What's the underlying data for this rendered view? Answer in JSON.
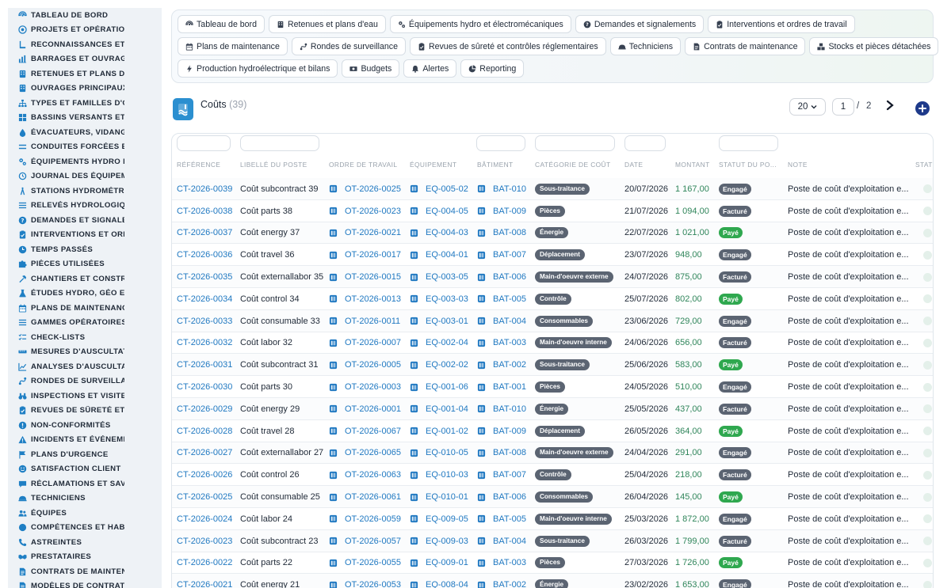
{
  "sidebar": {
    "items": [
      {
        "label": "TABLEAU DE BORD",
        "icon": "dashboard-icon"
      },
      {
        "label": "PROJETS ET OPÉRATIONS",
        "icon": "target-icon"
      },
      {
        "label": "RECONNAISSANCES ET VISITES",
        "icon": "map-pin-icon"
      },
      {
        "label": "BARRAGES ET OUVRAGES",
        "icon": "chart-icon"
      },
      {
        "label": "RETENUES ET PLANS D'EAU",
        "icon": "building-icon"
      },
      {
        "label": "OUVRAGES PRINCIPAUX",
        "icon": "building-icon"
      },
      {
        "label": "TYPES ET FAMILLES D'OUVRAGES",
        "icon": "sitemap-icon"
      },
      {
        "label": "BASSINS VERSANTS ET AFFLUENTS",
        "icon": "grid-icon"
      },
      {
        "label": "ÉVACUATEURS, VIDANGES",
        "icon": "drop-icon"
      },
      {
        "label": "CONDUITES FORCÉES ET GALERIES",
        "icon": "lines-icon"
      },
      {
        "label": "ÉQUIPEMENTS HYDRO ET ÉLECTROMÉCANIQUES",
        "icon": "gears-icon"
      },
      {
        "label": "JOURNAL DES ÉQUIPEMENTS",
        "icon": "history-icon"
      },
      {
        "label": "STATIONS HYDROMÉTRIQUES",
        "icon": "tower-icon"
      },
      {
        "label": "RELEVÉS HYDROLOGIQUES",
        "icon": "list-icon"
      },
      {
        "label": "DEMANDES ET SIGNALEMENTS",
        "icon": "question-icon"
      },
      {
        "label": "INTERVENTIONS ET ORDRES DE TRAVAIL",
        "icon": "clipboard-icon"
      },
      {
        "label": "TEMPS PASSÉS",
        "icon": "clock-icon"
      },
      {
        "label": "PIÈCES UTILISÉES",
        "icon": "puzzle-icon"
      },
      {
        "label": "CHANTIERS ET CONSTRUCTIONS",
        "icon": "hammer-icon"
      },
      {
        "label": "ÉTUDES HYDRO, GÉO ET STRUCTURE",
        "icon": "flask-icon"
      },
      {
        "label": "PLANS DE MAINTENANCE",
        "icon": "calendar-icon"
      },
      {
        "label": "GAMMES OPÉRATOIRES",
        "icon": "list-icon"
      },
      {
        "label": "CHECK-LISTS",
        "icon": "checklist-icon"
      },
      {
        "label": "MESURES D'AUSCULTATION",
        "icon": "ruler-icon"
      },
      {
        "label": "ANALYSES D'AUSCULTATION",
        "icon": "line-chart-icon"
      },
      {
        "label": "RONDES DE SURVEILLANCE",
        "icon": "route-icon"
      },
      {
        "label": "INSPECTIONS ET VISITES",
        "icon": "binoculars-icon"
      },
      {
        "label": "REVUES DE SÛRETÉ ET CONTRÔLES",
        "icon": "clipboard-icon"
      },
      {
        "label": "NON-CONFORMITÉS",
        "icon": "alert-circle-icon"
      },
      {
        "label": "INCIDENTS ET ÉVÉNEMENTS",
        "icon": "warning-icon"
      },
      {
        "label": "PLANS D'URGENCE",
        "icon": "flag-icon"
      },
      {
        "label": "SATISFACTION CLIENT",
        "icon": "smile-icon"
      },
      {
        "label": "RÉCLAMATIONS ET SAV",
        "icon": "chat-icon"
      },
      {
        "label": "TECHNICIENS",
        "icon": "helmet-icon"
      },
      {
        "label": "ÉQUIPES",
        "icon": "users-icon"
      },
      {
        "label": "COMPÉTENCES ET HABILITATIONS",
        "icon": "star-icon"
      },
      {
        "label": "ASTREINTES",
        "icon": "phone-icon"
      },
      {
        "label": "PRESTATAIRES",
        "icon": "handshake-icon"
      },
      {
        "label": "CONTRATS DE MAINTENANCE",
        "icon": "file-icon"
      },
      {
        "label": "MODÈLES DE CONTRATS",
        "icon": "file-icon"
      }
    ]
  },
  "toolbar": {
    "rows": [
      [
        {
          "label": "Tableau de bord",
          "icon": "dashboard-icon"
        },
        {
          "label": "Retenues et plans d'eau",
          "icon": "building-icon"
        },
        {
          "label": "Équipements hydro et électromécaniques",
          "icon": "gears-icon"
        },
        {
          "label": "Demandes et signalements",
          "icon": "question-icon"
        },
        {
          "label": "Interventions et ordres de travail",
          "icon": "clipboard-icon"
        }
      ],
      [
        {
          "label": "Plans de maintenance",
          "icon": "calendar-icon"
        },
        {
          "label": "Rondes de surveillance",
          "icon": "route-icon"
        },
        {
          "label": "Revues de sûreté et contrôles réglementaires",
          "icon": "clipboard-icon"
        },
        {
          "label": "Techniciens",
          "icon": "helmet-icon"
        },
        {
          "label": "Contrats de maintenance",
          "icon": "file-icon"
        },
        {
          "label": "Stocks et pièces détachées",
          "icon": "boxes-icon"
        }
      ],
      [
        {
          "label": "Production hydroélectrique et bilans",
          "icon": "bolt-icon"
        },
        {
          "label": "Budgets",
          "icon": "money-icon"
        },
        {
          "label": "Alertes",
          "icon": "bell-icon"
        },
        {
          "label": "Reporting",
          "icon": "pie-icon"
        }
      ]
    ]
  },
  "list": {
    "title": "Coûts",
    "count": "(39)",
    "page_size": "20",
    "page_current": "1",
    "page_separator": "/",
    "page_total": "2"
  },
  "table": {
    "columns": [
      "RÉFÉRENCE",
      "LIBELLÉ DU POSTE",
      "ORDRE DE TRAVAIL",
      "ÉQUIPEMENT",
      "BÂTIMENT",
      "CATÉGORIE DE COÛT",
      "DATE",
      "MONTANT",
      "STATUT DU PO...",
      "NOTE",
      "STATI"
    ],
    "rows": [
      {
        "ref": "CT-2026-0039",
        "label": "Coût subcontract 39",
        "ot": "OT-2026-0025",
        "eq": "EQ-005-02",
        "bat": "BAT-010",
        "cat": "Sous-traitance",
        "date": "20/07/2026",
        "amount": "1 167,00",
        "status": "Engagé",
        "note": "Poste de coût d'exploitation e..."
      },
      {
        "ref": "CT-2026-0038",
        "label": "Coût parts 38",
        "ot": "OT-2026-0023",
        "eq": "EQ-004-05",
        "bat": "BAT-009",
        "cat": "Pièces",
        "date": "21/07/2026",
        "amount": "1 094,00",
        "status": "Facturé",
        "note": "Poste de coût d'exploitation e..."
      },
      {
        "ref": "CT-2026-0037",
        "label": "Coût energy 37",
        "ot": "OT-2026-0021",
        "eq": "EQ-004-03",
        "bat": "BAT-008",
        "cat": "Énergie",
        "date": "22/07/2026",
        "amount": "1 021,00",
        "status": "Payé",
        "note": "Poste de coût d'exploitation e..."
      },
      {
        "ref": "CT-2026-0036",
        "label": "Coût travel 36",
        "ot": "OT-2026-0017",
        "eq": "EQ-004-01",
        "bat": "BAT-007",
        "cat": "Déplacement",
        "date": "23/07/2026",
        "amount": "948,00",
        "status": "Engagé",
        "note": "Poste de coût d'exploitation e..."
      },
      {
        "ref": "CT-2026-0035",
        "label": "Coût externallabor 35",
        "ot": "OT-2026-0015",
        "eq": "EQ-003-05",
        "bat": "BAT-006",
        "cat": "Main-d'oeuvre externe",
        "date": "24/07/2026",
        "amount": "875,00",
        "status": "Facturé",
        "note": "Poste de coût d'exploitation e..."
      },
      {
        "ref": "CT-2026-0034",
        "label": "Coût control 34",
        "ot": "OT-2026-0013",
        "eq": "EQ-003-03",
        "bat": "BAT-005",
        "cat": "Contrôle",
        "date": "25/07/2026",
        "amount": "802,00",
        "status": "Payé",
        "note": "Poste de coût d'exploitation e..."
      },
      {
        "ref": "CT-2026-0033",
        "label": "Coût consumable 33",
        "ot": "OT-2026-0011",
        "eq": "EQ-003-01",
        "bat": "BAT-004",
        "cat": "Consommables",
        "date": "23/06/2026",
        "amount": "729,00",
        "status": "Engagé",
        "note": "Poste de coût d'exploitation e..."
      },
      {
        "ref": "CT-2026-0032",
        "label": "Coût labor 32",
        "ot": "OT-2026-0007",
        "eq": "EQ-002-04",
        "bat": "BAT-003",
        "cat": "Main-d'oeuvre interne",
        "date": "24/06/2026",
        "amount": "656,00",
        "status": "Facturé",
        "note": "Poste de coût d'exploitation e..."
      },
      {
        "ref": "CT-2026-0031",
        "label": "Coût subcontract 31",
        "ot": "OT-2026-0005",
        "eq": "EQ-002-02",
        "bat": "BAT-002",
        "cat": "Sous-traitance",
        "date": "25/06/2026",
        "amount": "583,00",
        "status": "Payé",
        "note": "Poste de coût d'exploitation e..."
      },
      {
        "ref": "CT-2026-0030",
        "label": "Coût parts 30",
        "ot": "OT-2026-0003",
        "eq": "EQ-001-06",
        "bat": "BAT-001",
        "cat": "Pièces",
        "date": "24/05/2026",
        "amount": "510,00",
        "status": "Engagé",
        "note": "Poste de coût d'exploitation e..."
      },
      {
        "ref": "CT-2026-0029",
        "label": "Coût energy 29",
        "ot": "OT-2026-0001",
        "eq": "EQ-001-04",
        "bat": "BAT-010",
        "cat": "Énergie",
        "date": "25/05/2026",
        "amount": "437,00",
        "status": "Facturé",
        "note": "Poste de coût d'exploitation e..."
      },
      {
        "ref": "CT-2026-0028",
        "label": "Coût travel 28",
        "ot": "OT-2026-0067",
        "eq": "EQ-001-02",
        "bat": "BAT-009",
        "cat": "Déplacement",
        "date": "26/05/2026",
        "amount": "364,00",
        "status": "Payé",
        "note": "Poste de coût d'exploitation e..."
      },
      {
        "ref": "CT-2026-0027",
        "label": "Coût externallabor 27",
        "ot": "OT-2026-0065",
        "eq": "EQ-010-05",
        "bat": "BAT-008",
        "cat": "Main-d'oeuvre externe",
        "date": "24/04/2026",
        "amount": "291,00",
        "status": "Engagé",
        "note": "Poste de coût d'exploitation e..."
      },
      {
        "ref": "CT-2026-0026",
        "label": "Coût control 26",
        "ot": "OT-2026-0063",
        "eq": "EQ-010-03",
        "bat": "BAT-007",
        "cat": "Contrôle",
        "date": "25/04/2026",
        "amount": "218,00",
        "status": "Facturé",
        "note": "Poste de coût d'exploitation e..."
      },
      {
        "ref": "CT-2026-0025",
        "label": "Coût consumable 25",
        "ot": "OT-2026-0061",
        "eq": "EQ-010-01",
        "bat": "BAT-006",
        "cat": "Consommables",
        "date": "26/04/2026",
        "amount": "145,00",
        "status": "Payé",
        "note": "Poste de coût d'exploitation e..."
      },
      {
        "ref": "CT-2026-0024",
        "label": "Coût labor 24",
        "ot": "OT-2026-0059",
        "eq": "EQ-009-05",
        "bat": "BAT-005",
        "cat": "Main-d'oeuvre interne",
        "date": "25/03/2026",
        "amount": "1 872,00",
        "status": "Engagé",
        "note": "Poste de coût d'exploitation e..."
      },
      {
        "ref": "CT-2026-0023",
        "label": "Coût subcontract 23",
        "ot": "OT-2026-0057",
        "eq": "EQ-009-03",
        "bat": "BAT-004",
        "cat": "Sous-traitance",
        "date": "26/03/2026",
        "amount": "1 799,00",
        "status": "Facturé",
        "note": "Poste de coût d'exploitation e..."
      },
      {
        "ref": "CT-2026-0022",
        "label": "Coût parts 22",
        "ot": "OT-2026-0055",
        "eq": "EQ-009-01",
        "bat": "BAT-003",
        "cat": "Pièces",
        "date": "27/03/2026",
        "amount": "1 726,00",
        "status": "Payé",
        "note": "Poste de coût d'exploitation e..."
      },
      {
        "ref": "CT-2026-0021",
        "label": "Coût energy 21",
        "ot": "OT-2026-0053",
        "eq": "EQ-008-04",
        "bat": "BAT-002",
        "cat": "Énergie",
        "date": "23/02/2026",
        "amount": "1 653,00",
        "status": "Engagé",
        "note": "Poste de coût d'exploitation e..."
      }
    ]
  },
  "colors": {
    "link": "#1f78c1",
    "amount": "#2f855a",
    "badge_neutral": "#5b6472",
    "status_engage": "#5b6472",
    "status_facture": "#5b6472",
    "status_paye": "#2fa84f",
    "add_button": "#1e3a8a",
    "module_logo": "#2b8fd0"
  }
}
